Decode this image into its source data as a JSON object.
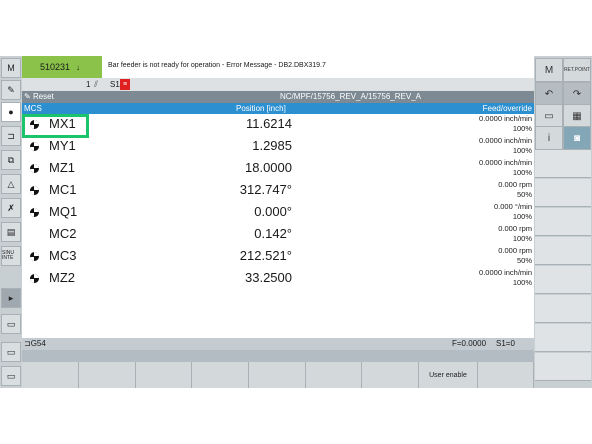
{
  "alarm": {
    "code": "510231",
    "message": "Bar feeder is not ready for operation - Error Message - DB2.DBX319.7"
  },
  "status": {
    "channel": "1",
    "spindle_label": "S1",
    "spindle_icon": "spindle-stop-icon"
  },
  "program": {
    "state": "Reset",
    "path": "NC/MPF/15756_REV_A/15756_REV_A"
  },
  "table": {
    "col_mcs": "MCS",
    "col_position": "Position [inch]",
    "col_feed": "Feed/override",
    "rows": [
      {
        "name": "MX1",
        "position": "11.6214",
        "feed": "0.0000 inch/min",
        "override": "100%",
        "icon": true
      },
      {
        "name": "MY1",
        "position": "1.2985",
        "feed": "0.0000 inch/min",
        "override": "100%",
        "icon": true
      },
      {
        "name": "MZ1",
        "position": "18.0000",
        "feed": "0.0000 inch/min",
        "override": "100%",
        "icon": true
      },
      {
        "name": "MC1",
        "position": "312.747°",
        "feed": "0.000 rpm",
        "override": "50%",
        "icon": true
      },
      {
        "name": "MQ1",
        "position": "0.000°",
        "feed": "0.000 °/min",
        "override": "100%",
        "icon": true
      },
      {
        "name": "MC2",
        "position": "0.142°",
        "feed": "0.000 rpm",
        "override": "100%",
        "icon": false
      },
      {
        "name": "MC3",
        "position": "212.521°",
        "feed": "0.000 rpm",
        "override": "50%",
        "icon": true
      },
      {
        "name": "MZ2",
        "position": "33.2500",
        "feed": "0.0000 inch/min",
        "override": "100%",
        "icon": true
      }
    ]
  },
  "bottom": {
    "wcs": "G54",
    "feed": "F=0.0000",
    "spindle": "S1=0"
  },
  "softkeys": [
    "",
    "",
    "",
    "",
    "",
    "",
    "",
    "User enable"
  ],
  "right_panel": {
    "ret_point": "RET.POINT",
    "m_label": "M",
    "info": "i"
  },
  "left_panel": {
    "m_label": "M",
    "sinu_label": "SINU INTE"
  },
  "colors": {
    "alarm_green": "#8bc34a",
    "header_blue": "#2b8fd0",
    "highlight": "#19c46a",
    "spindle_red": "#e02020"
  }
}
